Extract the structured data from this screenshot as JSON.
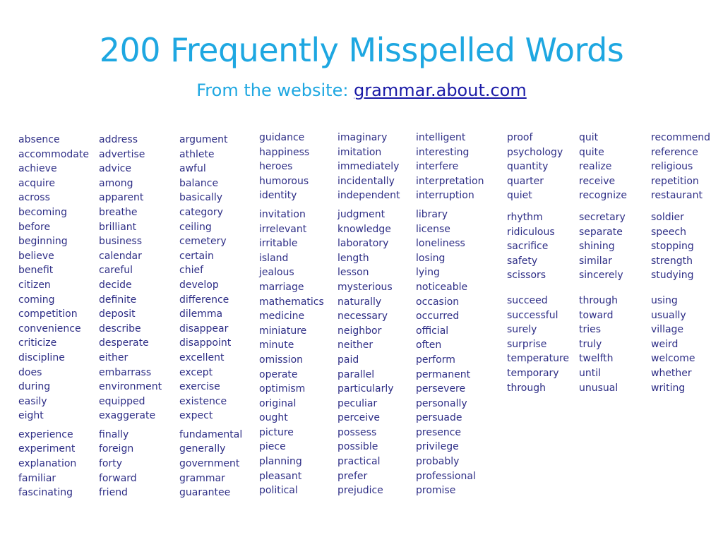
{
  "title": "200 Frequently Misspelled Words",
  "subtitle": {
    "prefix": "From the website: ",
    "link": "grammar.about.com"
  },
  "colors": {
    "title": "#1ea7e1",
    "link": "#1a1aa6",
    "words": "#2e2e86"
  },
  "columns": [
    {
      "groups": [
        [
          "absence",
          "accommodate",
          "achieve",
          "acquire",
          "across",
          "becoming",
          "before",
          "beginning",
          "believe",
          "benefit",
          "citizen",
          "coming",
          "competition",
          "convenience",
          "criticize",
          "discipline",
          "does",
          "during",
          "easily",
          "eight"
        ],
        [
          "experience",
          "experiment",
          "explanation",
          "familiar",
          "fascinating"
        ]
      ]
    },
    {
      "groups": [
        [
          "address",
          "advertise",
          "advice",
          "among",
          "apparent",
          "breathe",
          "brilliant",
          "business",
          "calendar",
          "careful",
          "decide",
          "definite",
          "deposit",
          "describe",
          "desperate",
          "either",
          "embarrass",
          "environment",
          "equipped",
          "exaggerate"
        ],
        [
          "finally",
          "foreign",
          "forty",
          "forward",
          "friend"
        ]
      ]
    },
    {
      "groups": [
        [
          "argument",
          "athlete",
          "awful",
          "balance",
          "basically",
          "category",
          "ceiling",
          "cemetery",
          "certain",
          "chief",
          "develop",
          "difference",
          "dilemma",
          "disappear",
          "disappoint",
          "excellent",
          "except",
          "exercise",
          "existence",
          "expect"
        ],
        [
          "fundamental",
          "generally",
          "government",
          "grammar",
          "guarantee"
        ]
      ]
    },
    {
      "groups": [
        [
          "guidance",
          "happiness",
          "heroes",
          "humorous",
          "identity"
        ],
        [
          "invitation",
          "irrelevant",
          "irritable",
          "island",
          "jealous",
          "marriage",
          "mathematics",
          "medicine",
          "miniature",
          "minute",
          "omission",
          "operate",
          "optimism",
          "original",
          "ought",
          "picture",
          "piece",
          "planning",
          "pleasant",
          "political"
        ]
      ]
    },
    {
      "groups": [
        [
          "imaginary",
          "imitation",
          "immediately",
          "incidentally",
          "independent"
        ],
        [
          "judgment",
          "knowledge",
          "laboratory",
          "length",
          "lesson",
          "mysterious",
          "naturally",
          "necessary",
          "neighbor",
          "neither",
          "paid",
          "parallel",
          "particularly",
          "peculiar",
          "perceive",
          "possess",
          "possible",
          "practical",
          "prefer",
          "prejudice"
        ]
      ]
    },
    {
      "groups": [
        [
          "intelligent",
          "interesting",
          "interfere",
          "interpretation",
          "interruption"
        ],
        [
          "library",
          "license",
          "loneliness",
          "losing",
          "lying",
          "noticeable",
          "occasion",
          "occurred",
          "official",
          "often",
          "perform",
          "permanent",
          "persevere",
          "personally",
          "persuade",
          "presence",
          "privilege",
          "probably",
          "professional",
          "promise"
        ]
      ]
    },
    {
      "groups": [
        [
          "proof",
          "psychology",
          "quantity",
          "quarter",
          "quiet"
        ],
        [
          "rhythm",
          "ridiculous",
          "sacrifice",
          "safety",
          "scissors"
        ],
        [
          "succeed",
          "successful",
          "surely",
          "surprise",
          "temperature",
          "temporary",
          "through"
        ]
      ]
    },
    {
      "groups": [
        [
          "quit",
          "quite",
          "realize",
          "receive",
          "recognize"
        ],
        [
          "secretary",
          "separate",
          "shining",
          "similar",
          "sincerely"
        ],
        [
          "through",
          "toward",
          "tries",
          "truly",
          "twelfth",
          "until",
          "unusual"
        ]
      ]
    },
    {
      "groups": [
        [
          "recommend",
          "reference",
          "religious",
          "repetition",
          "restaurant"
        ],
        [
          "soldier",
          "speech",
          "stopping",
          "strength",
          "studying"
        ],
        [
          "using",
          "usually",
          "village",
          "weird",
          "welcome",
          "whether",
          "writing"
        ]
      ]
    }
  ]
}
